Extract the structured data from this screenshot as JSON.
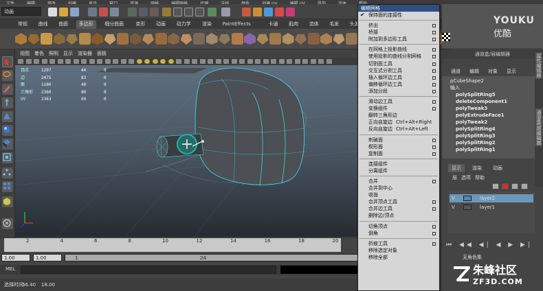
{
  "top_menu": [
    "文件",
    "编辑",
    "修改",
    "创建",
    "显示",
    "窗口",
    "资源",
    "网格",
    "编辑网格",
    "代理",
    "法线",
    "颜色",
    "创建 UV",
    "编辑 UV",
    "肌肉",
    "流体",
    "帮助"
  ],
  "status_line": {
    "mode_combo": "动画",
    "field_y_label": "Y:",
    "field_z_label": "Z:"
  },
  "shelf_tabs": [
    "常规",
    "曲线",
    "曲面",
    "多边形",
    "细分曲面",
    "变形",
    "动画",
    "动力学",
    "渲染",
    "PaintEffects",
    "卡通",
    "肌肉",
    "流体",
    "毛发",
    "头发"
  ],
  "active_shelf_tab": "多边形",
  "viewport": {
    "menu": [
      "视图",
      "着色",
      "照明",
      "显示",
      "渲染器",
      "面板"
    ],
    "hud": [
      {
        "label": "顶点",
        "c1": "1297",
        "c2": "44",
        "c3": "0"
      },
      {
        "label": "边",
        "c1": "2475",
        "c2": "83",
        "c3": "0"
      },
      {
        "label": "面",
        "c1": "1180",
        "c2": "40",
        "c3": "0"
      },
      {
        "label": "三角形",
        "c1": "2360",
        "c2": "80",
        "c3": "0"
      },
      {
        "label": "UV",
        "c1": "2363",
        "c2": "60",
        "c3": "0"
      }
    ],
    "colors": {
      "mesh": "#4c4f53",
      "wire": "#3fd6e6",
      "manipulator": "#1fb3a6",
      "background_top": "#5e6f7f",
      "background_bottom": "#262b31"
    }
  },
  "timeline": {
    "ticks": [
      "2",
      "4",
      "6",
      "8",
      "10",
      "12",
      "14",
      "16",
      "18",
      "20"
    ]
  },
  "range": {
    "start": "1.00",
    "start_inner": "1.00",
    "current": "1",
    "end_inner": "24"
  },
  "mel": {
    "label": "MEL"
  },
  "help_line": {
    "prefix": "选择时间:",
    "v1": "56.40",
    "v2": "18.00"
  },
  "menu": {
    "title": "编辑网格",
    "items": [
      {
        "label": "保持面的连接性",
        "check": true
      },
      {
        "sep": true
      },
      {
        "label": "挤出",
        "box": true
      },
      {
        "label": "桥接",
        "box": true
      },
      {
        "label": "附加到多边形工具",
        "box": true
      },
      {
        "sep": true
      },
      {
        "label": "在网格上投影曲线",
        "box": true
      },
      {
        "label": "使用投影的曲线分割网格",
        "box": true
      },
      {
        "label": "切割面工具",
        "box": true
      },
      {
        "label": "交互式分割工具",
        "box": true
      },
      {
        "label": "插入循环边工具",
        "box": true
      },
      {
        "label": "偏移循环边工具",
        "box": true
      },
      {
        "label": "添加分段",
        "box": true
      },
      {
        "sep": true
      },
      {
        "label": "滑动边工具",
        "box": true
      },
      {
        "label": "变换组件",
        "box": true
      },
      {
        "label": "翻转三角形边"
      },
      {
        "label": "正向自旋边",
        "shortcut": "Ctrl+Alt+Right"
      },
      {
        "label": "反向自旋边",
        "shortcut": "Ctrl+Alt+Left"
      },
      {
        "sep": true
      },
      {
        "label": "刺破面",
        "box": true
      },
      {
        "label": "楔形面",
        "box": true
      },
      {
        "label": "复制面",
        "box": true
      },
      {
        "sep": true
      },
      {
        "label": "连接组件"
      },
      {
        "label": "分离组件"
      },
      {
        "sep": true
      },
      {
        "label": "合并",
        "box": true
      },
      {
        "label": "合并到中心"
      },
      {
        "label": "收拢"
      },
      {
        "label": "合并顶点工具",
        "box": true
      },
      {
        "label": "合并边工具",
        "box": true
      },
      {
        "label": "删除边/顶点"
      },
      {
        "sep": true
      },
      {
        "label": "切角顶点",
        "box": true
      },
      {
        "label": "倒角",
        "box": true
      },
      {
        "sep": true
      },
      {
        "label": "折痕工具",
        "box": true
      },
      {
        "label": "移除选定对象"
      },
      {
        "label": "移除全部"
      }
    ]
  },
  "attr_editor": {
    "title": "通道盒/层编辑器",
    "menu": [
      "通道",
      "编辑",
      "对象",
      "显示"
    ],
    "object": "pCubeShape2",
    "inputs_label": "输入",
    "history": [
      "polySplitRing5",
      "deleteComponent1",
      "polyTweak3",
      "polyExtrudeFace1",
      "polyTweak2",
      "polySplitRing4",
      "polySplitRing3",
      "polySplitRing2",
      "polySplitRing1"
    ]
  },
  "layer_editor": {
    "tabs": [
      "显示",
      "渲染",
      "动画"
    ],
    "menu": [
      "层",
      "选项",
      "帮助"
    ],
    "layers": [
      {
        "v": "V",
        "name": "layer2",
        "selected": true
      },
      {
        "v": "V",
        "name": "layer1",
        "selected": false
      }
    ]
  },
  "side_tabs": [
    "属性编辑器",
    "通道盒/层编辑器"
  ],
  "playback_glyphs": "⏮ ◀◀ ◀| ◀ ▶ ▶| ▶▶ ⏭",
  "char_set": {
    "label": "无角色集"
  },
  "watermarks": {
    "youku_en": "YOUKU",
    "youku_cn": "优酷",
    "zf3d_cn": "朱峰社区",
    "zf3d_en": "ZF3D.COM"
  }
}
